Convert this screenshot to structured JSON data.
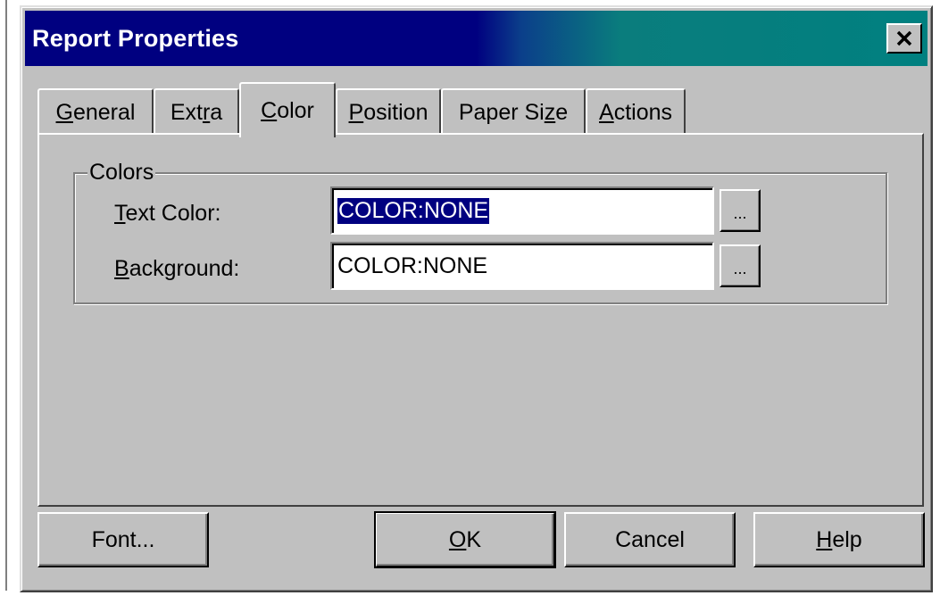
{
  "window": {
    "title": "Report Properties"
  },
  "tabs": [
    {
      "label": "General",
      "underline": "G",
      "rest": "eneral"
    },
    {
      "label": "Extra",
      "pre": "Ext",
      "underline": "r",
      "rest": "a"
    },
    {
      "label": "Color",
      "underline": "C",
      "rest": "olor",
      "active": true
    },
    {
      "label": "Position",
      "underline": "P",
      "rest": "osition"
    },
    {
      "label": "Paper Size",
      "pre": "Paper Si",
      "underline": "z",
      "rest": "e"
    },
    {
      "label": "Actions",
      "underline": "A",
      "rest": "ctions"
    }
  ],
  "colors_group": {
    "legend": "Colors",
    "text_color": {
      "label_u": "T",
      "label_rest": "ext Color:",
      "value": "COLOR:NONE",
      "button": "..."
    },
    "background": {
      "label_u": "B",
      "label_rest": "ackground:",
      "value": "COLOR:NONE",
      "button": "..."
    }
  },
  "buttons": {
    "font": "Font...",
    "ok_u": "O",
    "ok_rest": "K",
    "cancel": "Cancel",
    "help_u": "H",
    "help_rest": "elp"
  },
  "colors": {
    "title_bar": "#000080",
    "title_bar_end": "#008080",
    "face": "#c0c0c0",
    "selection": "#000080"
  }
}
